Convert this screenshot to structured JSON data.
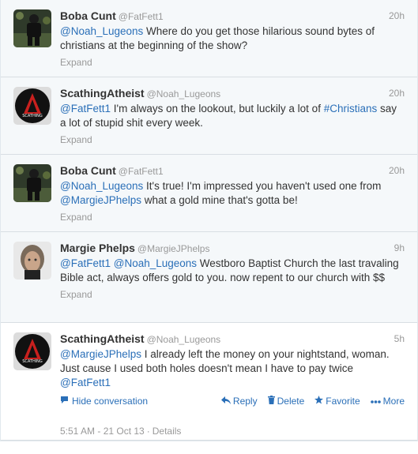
{
  "tweets": [
    {
      "fullname": "Boba Cunt",
      "username": "@FatFett1",
      "time": "20h",
      "text_parts": [
        {
          "t": "@Noah_Lugeons",
          "link": true
        },
        {
          "t": " Where do you get those hilarious sound bytes of christians at the beginning of the show?",
          "link": false
        }
      ],
      "expand": "Expand"
    },
    {
      "fullname": "ScathingAtheist",
      "username": "@Noah_Lugeons",
      "time": "20h",
      "text_parts": [
        {
          "t": "@FatFett1",
          "link": true
        },
        {
          "t": " I'm always on the lookout, but luckily a lot of ",
          "link": false
        },
        {
          "t": "#Christians",
          "link": true
        },
        {
          "t": " say a lot of stupid shit every week.",
          "link": false
        }
      ],
      "expand": "Expand"
    },
    {
      "fullname": "Boba Cunt",
      "username": "@FatFett1",
      "time": "20h",
      "text_parts": [
        {
          "t": "@Noah_Lugeons",
          "link": true
        },
        {
          "t": " It's true! I'm impressed you haven't used one from ",
          "link": false
        },
        {
          "t": "@MargieJPhelps",
          "link": true
        },
        {
          "t": " what a gold mine that's gotta be!",
          "link": false
        }
      ],
      "expand": "Expand"
    },
    {
      "fullname": "Margie Phelps",
      "username": "@MargieJPhelps",
      "time": "9h",
      "text_parts": [
        {
          "t": "@FatFett1",
          "link": true
        },
        {
          "t": " ",
          "link": false
        },
        {
          "t": "@Noah_Lugeons",
          "link": true
        },
        {
          "t": " Westboro Baptist Church the last travaling Bible act, always offers gold to you. now repent to our church with $$",
          "link": false
        }
      ],
      "expand": "Expand"
    },
    {
      "fullname": "ScathingAtheist",
      "username": "@Noah_Lugeons",
      "time": "5h",
      "text_parts": [
        {
          "t": "@MargieJPhelps",
          "link": true
        },
        {
          "t": " I already left the money on your nightstand, woman. Just cause I used both holes doesn't mean I have to pay twice ",
          "link": false
        },
        {
          "t": "@FatFett1",
          "link": true
        }
      ]
    }
  ],
  "main_actions": {
    "hide_conversation": "Hide conversation",
    "reply": "Reply",
    "delete": "Delete",
    "favorite": "Favorite",
    "more": "More"
  },
  "details": {
    "timestamp": "5:51 AM - 21 Oct 13",
    "separator": "·",
    "link": "Details"
  },
  "colors": {
    "link": "#2a6fb8",
    "muted": "#999999",
    "collapsed_bg": "#f5f8fa"
  }
}
